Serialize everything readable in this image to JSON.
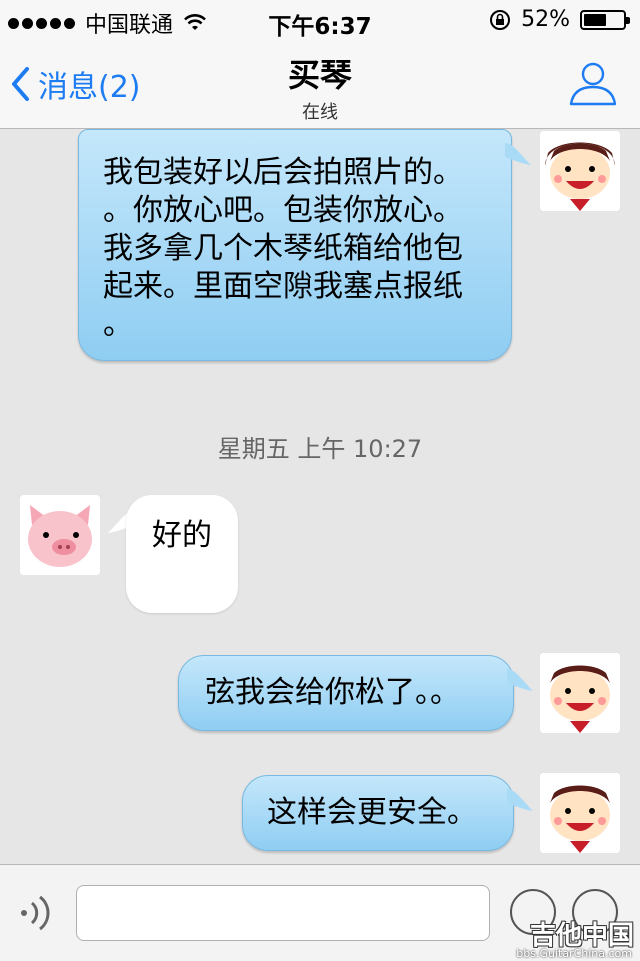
{
  "status": {
    "carrier": "中国联通",
    "time": "下午6:37",
    "battery_percent": "52%",
    "battery_level": 0.52
  },
  "nav": {
    "back_label": "消息(2)",
    "title": "买琴",
    "subtitle": "在线"
  },
  "messages": [
    {
      "sender": "me",
      "text": [
        "我包装好以后会拍照片的。",
        "。你放心吧。包装你放心。",
        "我多拿几个木琴纸箱给他包",
        "起来。里面空隙我塞点报纸",
        "。"
      ]
    },
    {
      "type": "timestamp",
      "text": "星期五 上午 10:27"
    },
    {
      "sender": "other",
      "text": "好的"
    },
    {
      "sender": "me",
      "text": "弦我会给你松了。。"
    },
    {
      "sender": "me",
      "text": "这样会更安全。"
    }
  ],
  "input": {
    "placeholder": ""
  },
  "watermark": {
    "main": "吉他中国",
    "sub": "bbs.GuitarChina.com"
  },
  "colors": {
    "accent": "#1e7cf2",
    "bubble_me": "#a9dbf6",
    "bubble_other": "#ffffff",
    "background": "#e6e6e6"
  }
}
